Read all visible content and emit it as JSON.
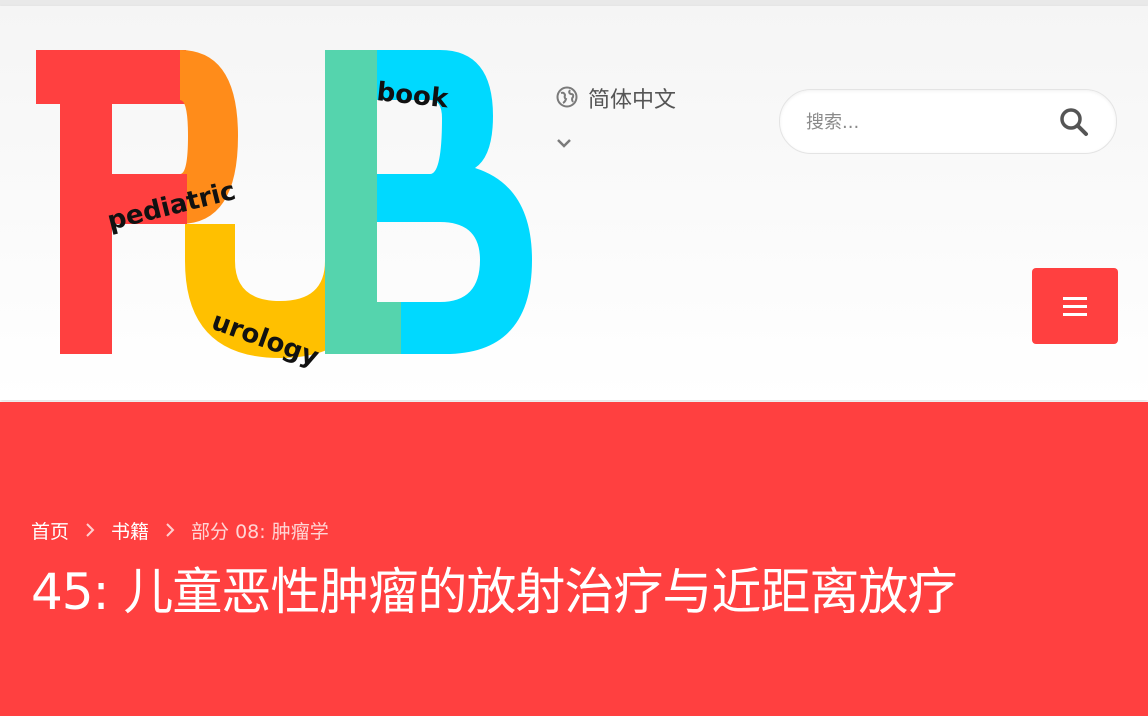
{
  "logo": {
    "words": {
      "pediatric": "pediatric",
      "urology": "urology",
      "book": "book"
    },
    "colors": {
      "red": "#ff4040",
      "orange": "#ff8c1a",
      "yellow": "#ffc000",
      "teal": "#55d4ad",
      "cyan": "#00d9ff"
    }
  },
  "language": {
    "label": "简体中文",
    "icon": "globe-icon",
    "chevron": "chevron-down-icon"
  },
  "search": {
    "placeholder": "搜索...",
    "icon": "search-icon"
  },
  "menu": {
    "icon": "hamburger-icon",
    "color": "#ff4040"
  },
  "breadcrumb": {
    "items": [
      {
        "label": "首页"
      },
      {
        "label": "书籍"
      },
      {
        "label": "部分 08: 肿瘤学"
      }
    ],
    "separator_icon": "chevron-right-icon"
  },
  "page": {
    "title": "45: 儿童恶性肿瘤的放射治疗与近距离放疗"
  },
  "theme": {
    "accent": "#ff4040",
    "header_bg": "#f5f5f5"
  }
}
